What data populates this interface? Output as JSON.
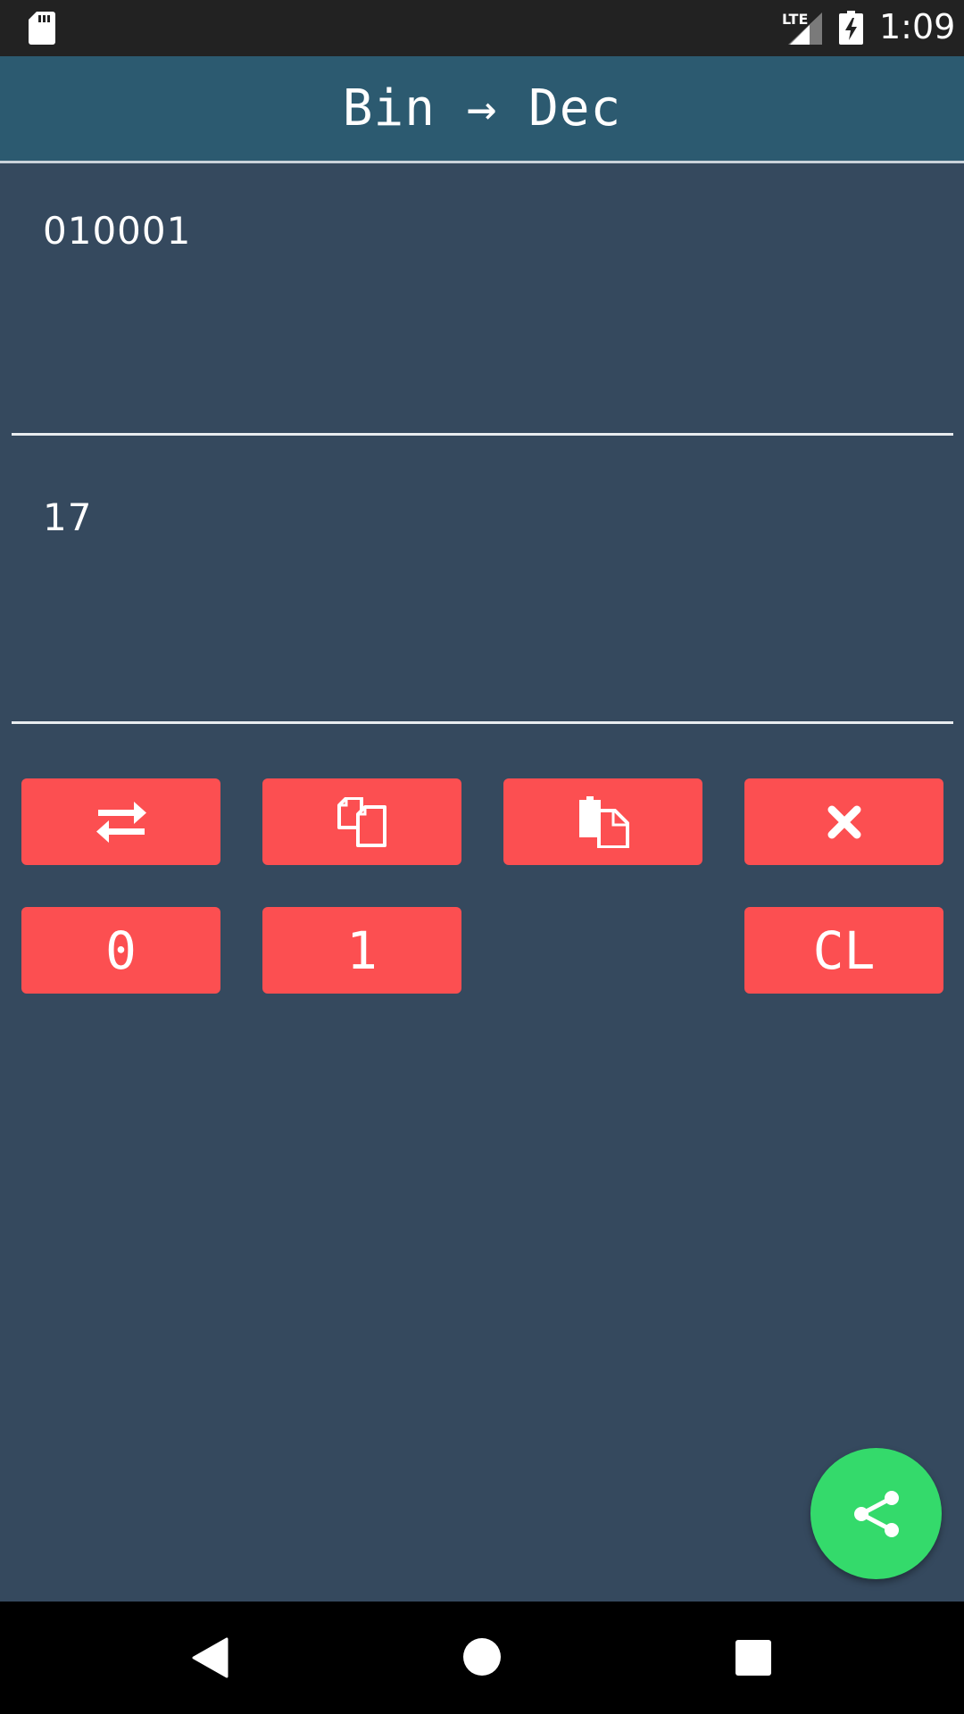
{
  "status_bar": {
    "network_label": "LTE",
    "time": "1:09",
    "icons": [
      "sd-card-icon",
      "signal-icon",
      "battery-charging-icon"
    ]
  },
  "app_bar": {
    "title": "Bin → Dec"
  },
  "converter": {
    "input_value": "010001",
    "output_value": "17"
  },
  "buttons": {
    "swap_icon": "swap-arrows-icon",
    "copy_icon": "copy-icon",
    "paste_icon": "paste-icon",
    "delete_icon": "close-x-icon",
    "zero_label": "0",
    "one_label": "1",
    "clear_label": "CL"
  },
  "fab": {
    "icon": "share-icon"
  },
  "nav_bar": {
    "icons": [
      "back-icon",
      "home-icon",
      "recents-icon"
    ]
  },
  "colors": {
    "background": "#35495e",
    "app_bar": "#2c5a70",
    "button": "#fc4f51",
    "fab": "#34da6b",
    "status_bar": "#222222"
  }
}
